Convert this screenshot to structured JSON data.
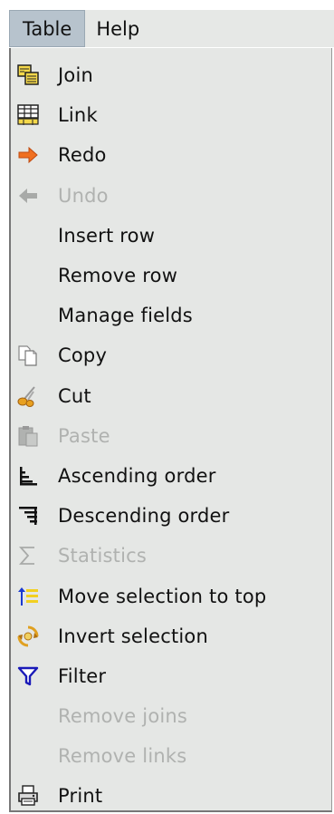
{
  "menubar": {
    "items": [
      {
        "label": "Table",
        "active": true
      },
      {
        "label": "Help",
        "active": false
      }
    ]
  },
  "menu": {
    "items": [
      {
        "label": "Join",
        "icon": "join-icon",
        "enabled": true
      },
      {
        "label": "Link",
        "icon": "link-icon",
        "enabled": true
      },
      {
        "label": "Redo",
        "icon": "redo-icon",
        "enabled": true
      },
      {
        "label": "Undo",
        "icon": "undo-icon",
        "enabled": false
      },
      {
        "label": "Insert row",
        "icon": "",
        "enabled": true
      },
      {
        "label": "Remove row",
        "icon": "",
        "enabled": true
      },
      {
        "label": "Manage fields",
        "icon": "",
        "enabled": true
      },
      {
        "label": "Copy",
        "icon": "copy-icon",
        "enabled": true
      },
      {
        "label": "Cut",
        "icon": "cut-icon",
        "enabled": true
      },
      {
        "label": "Paste",
        "icon": "paste-icon",
        "enabled": false
      },
      {
        "label": "Ascending order",
        "icon": "ascending-order-icon",
        "enabled": true
      },
      {
        "label": "Descending order",
        "icon": "descending-order-icon",
        "enabled": true
      },
      {
        "label": "Statistics",
        "icon": "statistics-icon",
        "enabled": false
      },
      {
        "label": "Move selection to top",
        "icon": "move-selection-top-icon",
        "enabled": true
      },
      {
        "label": "Invert selection",
        "icon": "invert-selection-icon",
        "enabled": true
      },
      {
        "label": "Filter",
        "icon": "filter-icon",
        "enabled": true
      },
      {
        "label": "Remove joins",
        "icon": "",
        "enabled": false
      },
      {
        "label": "Remove links",
        "icon": "",
        "enabled": false
      },
      {
        "label": "Print",
        "icon": "print-icon",
        "enabled": true
      }
    ]
  },
  "colors": {
    "menu_bg": "#e5e7e5",
    "active_menubar_bg": "#b7c3cd",
    "disabled_text": "#b0b2b0",
    "redo_arrow": "#f07020",
    "filter_blue": "#1a1ab8"
  }
}
